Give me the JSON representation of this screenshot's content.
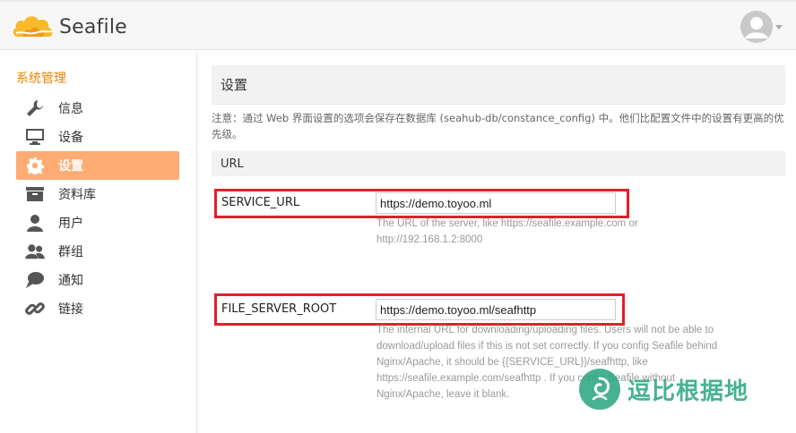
{
  "app": {
    "name": "Seafile"
  },
  "sidebar": {
    "title": "系统管理",
    "items": [
      {
        "label": "信息",
        "icon": "wrench-icon"
      },
      {
        "label": "设备",
        "icon": "monitor-icon"
      },
      {
        "label": "设置",
        "icon": "gear-icon",
        "active": true
      },
      {
        "label": "资料库",
        "icon": "archive-icon"
      },
      {
        "label": "用户",
        "icon": "user-icon"
      },
      {
        "label": "群组",
        "icon": "users-icon"
      },
      {
        "label": "通知",
        "icon": "chat-icon"
      },
      {
        "label": "链接",
        "icon": "link-icon"
      }
    ]
  },
  "main": {
    "title": "设置",
    "note": "注意：通过 Web 界面设置的选项会保存在数据库 (seahub-db/constance_config) 中。他们比配置文件中的设置有更高的优先级。",
    "section": "URL",
    "settings": [
      {
        "label": "SERVICE_URL",
        "value": "https://demo.toyoo.ml",
        "help": "The URL of the server, like https://seafile.example.com or http://192.168.1.2:8000"
      },
      {
        "label": "FILE_SERVER_ROOT",
        "value": "https://demo.toyoo.ml/seafhttp",
        "help": "The internal URL for downloading/uploading files. Users will not be able to download/upload files if this is not set correctly. If you config Seafile behind Nginx/Apache, it should be {{SERVICE_URL}}/seafhttp, like https://seafile.example.com/seafhttp . If you config Seafile without Nginx/Apache, leave it blank."
      }
    ]
  },
  "watermark": {
    "text": "逗比根据地"
  },
  "colors": {
    "accent": "#eb8205",
    "active_bg": "#feac74",
    "highlight": "#e0202a",
    "watermark": "#27a57f"
  }
}
